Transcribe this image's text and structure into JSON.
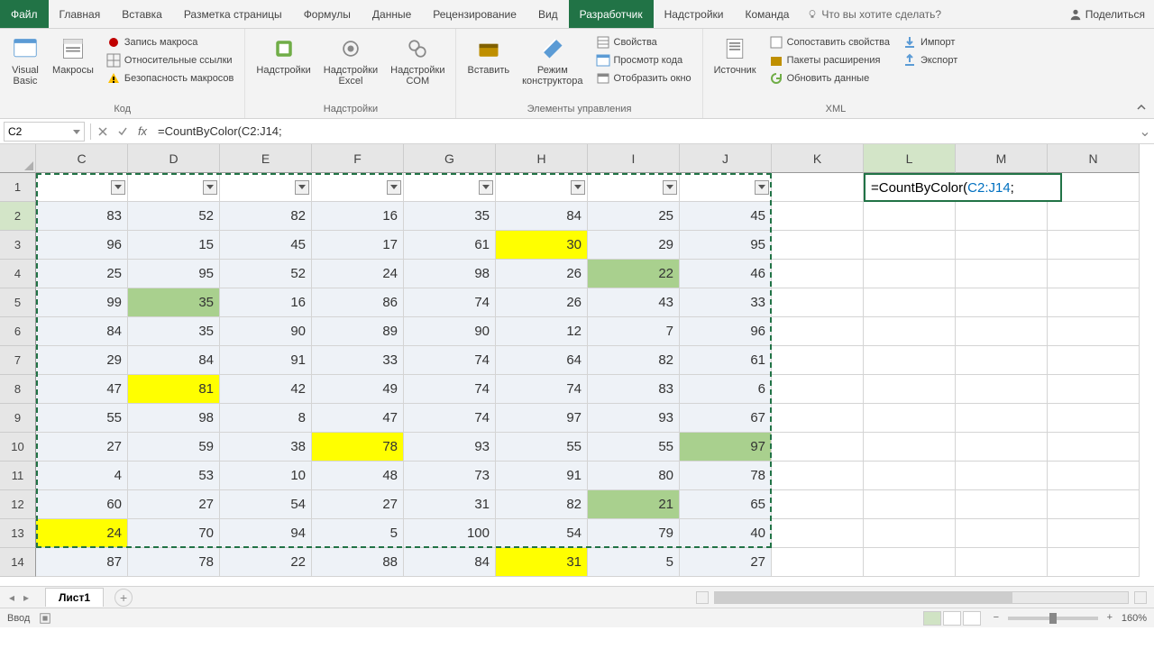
{
  "tabs": {
    "file": "Файл",
    "home": "Главная",
    "insert": "Вставка",
    "layout": "Разметка страницы",
    "formulas": "Формулы",
    "data": "Данные",
    "review": "Рецензирование",
    "view": "Вид",
    "developer": "Разработчик",
    "addins": "Надстройки",
    "team": "Команда",
    "tell_me": "Что вы хотите сделать?",
    "share": "Поделиться"
  },
  "ribbon": {
    "code": {
      "vb": "Visual\nBasic",
      "macros": "Макросы",
      "record": "Запись макроса",
      "relative": "Относительные ссылки",
      "security": "Безопасность макросов",
      "label": "Код"
    },
    "addins": {
      "addins": "Надстройки",
      "excel": "Надстройки\nExcel",
      "com": "Надстройки\nCOM",
      "label": "Надстройки"
    },
    "controls": {
      "insert": "Вставить",
      "design": "Режим\nконструктора",
      "props": "Свойства",
      "viewcode": "Просмотр кода",
      "showdlg": "Отобразить окно",
      "label": "Элементы управления"
    },
    "xml": {
      "source": "Источник",
      "mapprops": "Сопоставить свойства",
      "expansion": "Пакеты расширения",
      "refresh": "Обновить данные",
      "import": "Импорт",
      "export": "Экспорт",
      "label": "XML"
    }
  },
  "namebox": "C2",
  "formula": "=CountByColor(C2:J14;",
  "formula_prefix": "=CountByColor(",
  "formula_ref": "C2:J14",
  "formula_suffix": ";",
  "columns": [
    "C",
    "D",
    "E",
    "F",
    "G",
    "H",
    "I",
    "J",
    "K",
    "L",
    "M",
    "N"
  ],
  "rows": [
    "1",
    "2",
    "3",
    "4",
    "5",
    "6",
    "7",
    "8",
    "9",
    "10",
    "11",
    "12",
    "13",
    "14"
  ],
  "grid": [
    [
      null,
      null,
      null,
      null,
      null,
      null,
      null,
      null,
      null,
      null,
      null,
      null
    ],
    [
      83,
      52,
      82,
      16,
      35,
      84,
      25,
      45,
      null,
      null,
      null,
      null
    ],
    [
      96,
      15,
      45,
      17,
      61,
      30,
      29,
      95,
      null,
      null,
      null,
      null
    ],
    [
      25,
      95,
      52,
      24,
      98,
      26,
      22,
      46,
      null,
      null,
      null,
      null
    ],
    [
      99,
      35,
      16,
      86,
      74,
      26,
      43,
      33,
      null,
      null,
      null,
      null
    ],
    [
      84,
      35,
      90,
      89,
      90,
      12,
      7,
      96,
      null,
      null,
      null,
      null
    ],
    [
      29,
      84,
      91,
      33,
      74,
      64,
      82,
      61,
      null,
      null,
      null,
      null
    ],
    [
      47,
      81,
      42,
      49,
      74,
      74,
      83,
      6,
      null,
      null,
      null,
      null
    ],
    [
      55,
      98,
      8,
      47,
      74,
      97,
      93,
      67,
      null,
      null,
      null,
      null
    ],
    [
      27,
      59,
      38,
      78,
      93,
      55,
      55,
      97,
      null,
      null,
      null,
      null
    ],
    [
      4,
      53,
      10,
      48,
      73,
      91,
      80,
      78,
      null,
      null,
      null,
      null
    ],
    [
      60,
      27,
      54,
      27,
      31,
      82,
      21,
      65,
      null,
      null,
      null,
      null
    ],
    [
      24,
      70,
      94,
      5,
      100,
      54,
      79,
      40,
      null,
      null,
      null,
      null
    ],
    [
      87,
      78,
      22,
      88,
      84,
      31,
      5,
      27,
      null,
      null,
      null,
      null
    ]
  ],
  "highlights": {
    "yellow": [
      [
        2,
        5
      ],
      [
        4,
        1
      ],
      [
        7,
        1
      ],
      [
        9,
        3
      ],
      [
        12,
        0
      ],
      [
        13,
        5
      ]
    ],
    "green": [
      [
        3,
        6
      ],
      [
        4,
        1
      ],
      [
        9,
        7
      ],
      [
        11,
        6
      ]
    ]
  },
  "highlights_map": {
    "2-5": "yellow",
    "7-1": "yellow",
    "9-3": "yellow",
    "12-0": "yellow",
    "13-5": "yellow",
    "3-6": "green",
    "4-1": "green",
    "9-7": "green",
    "11-6": "green"
  },
  "sheet": {
    "name": "Лист1"
  },
  "status": {
    "mode": "Ввод",
    "zoom": "160%"
  }
}
